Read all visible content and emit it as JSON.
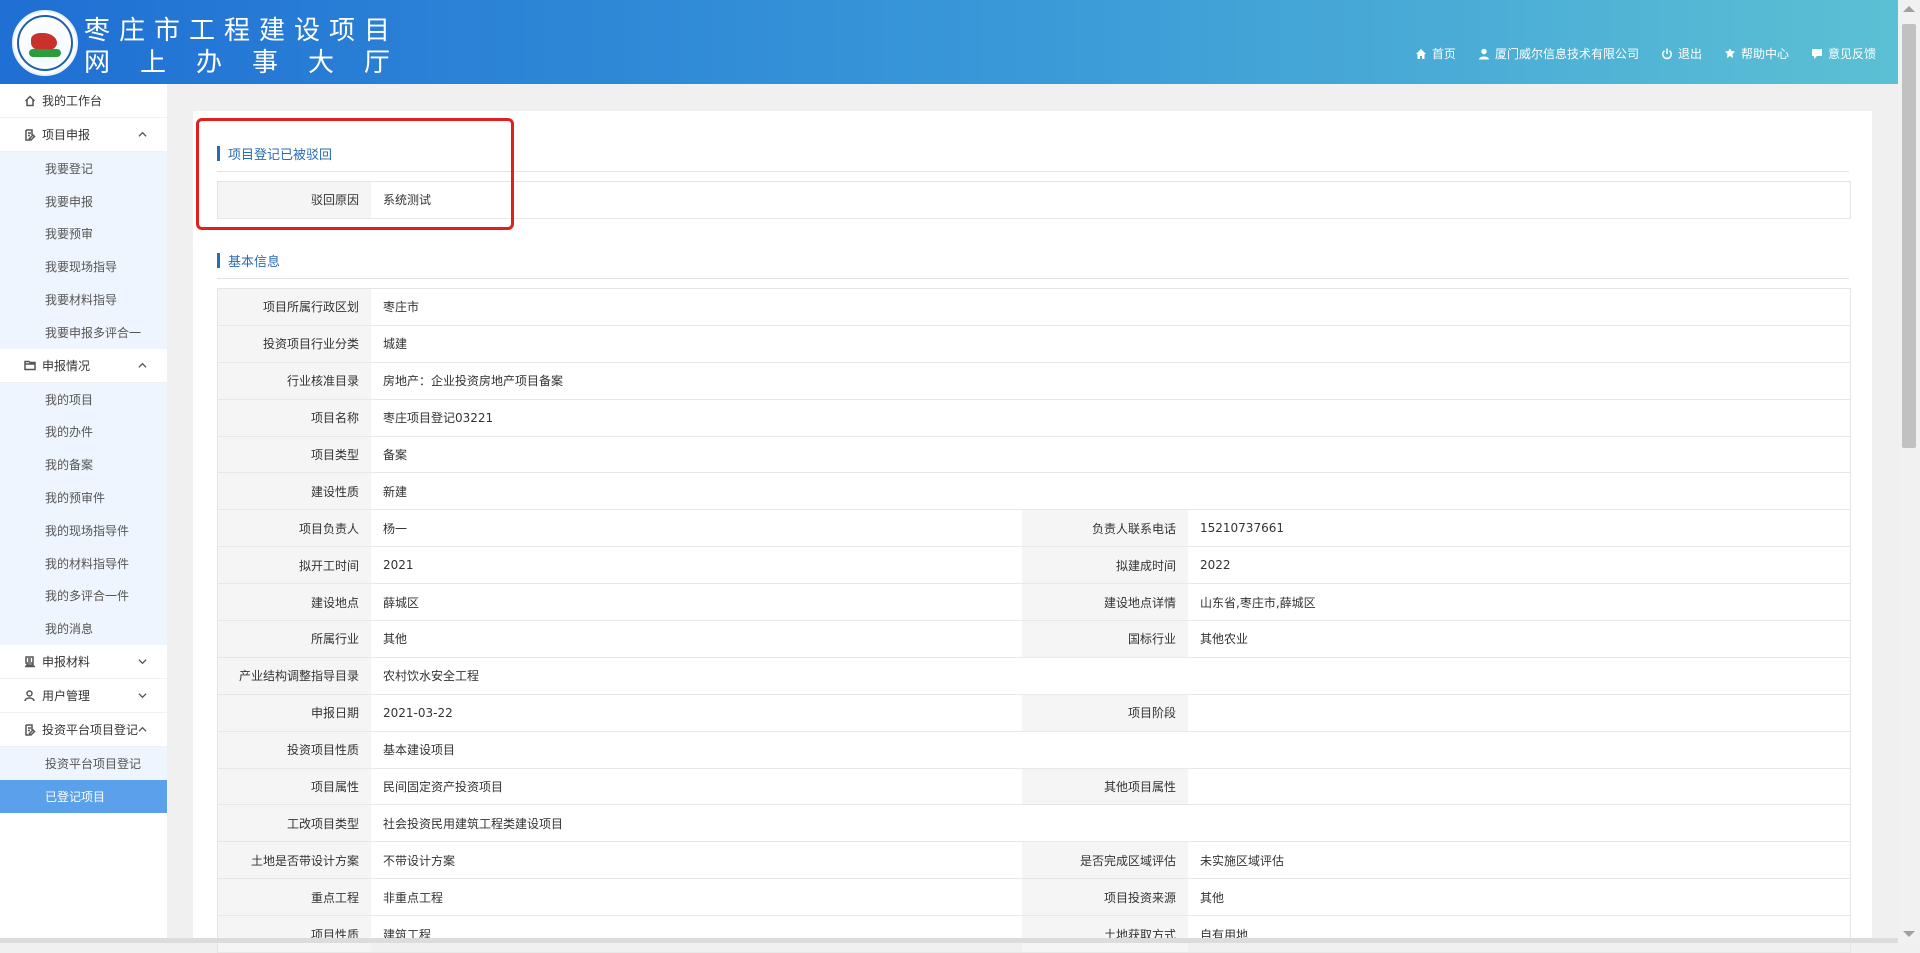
{
  "header": {
    "title_line1": "枣庄市工程建设项目",
    "title_line2": "网上办事大厅",
    "nav": [
      {
        "icon": "home-icon",
        "label": "首页"
      },
      {
        "icon": "user-icon",
        "label": "厦门威尔信息技术有限公司"
      },
      {
        "icon": "power-icon",
        "label": "退出"
      },
      {
        "icon": "help-icon",
        "label": "帮助中心"
      },
      {
        "icon": "feedback-icon",
        "label": "意见反馈"
      }
    ]
  },
  "sidebar": {
    "workbench": "我的工作台",
    "groups": [
      {
        "label": "项目申报",
        "expanded": true,
        "items": [
          "我要登记",
          "我要申报",
          "我要预审",
          "我要现场指导",
          "我要材料指导",
          "我要申报多评合一"
        ]
      },
      {
        "label": "申报情况",
        "expanded": true,
        "items": [
          "我的项目",
          "我的办件",
          "我的备案",
          "我的预审件",
          "我的现场指导件",
          "我的材料指导件",
          "我的多评合一件",
          "我的消息"
        ]
      },
      {
        "label": "申报材料",
        "expanded": false,
        "items": []
      },
      {
        "label": "用户管理",
        "expanded": false,
        "items": []
      },
      {
        "label": "投资平台项目登记",
        "expanded": true,
        "items": [
          "投资平台项目登记",
          "已登记项目"
        ]
      }
    ],
    "active_item": "已登记项目"
  },
  "rejected": {
    "title": "项目登记已被驳回",
    "reason_label": "驳回原因",
    "reason_value": "系统测试"
  },
  "basic": {
    "title": "基本信息",
    "rows": [
      [
        [
          "项目所属行政区划",
          "枣庄市"
        ]
      ],
      [
        [
          "投资项目行业分类",
          "城建"
        ]
      ],
      [
        [
          "行业核准目录",
          "房地产：企业投资房地产项目备案"
        ]
      ],
      [
        [
          "项目名称",
          "枣庄项目登记03221"
        ]
      ],
      [
        [
          "项目类型",
          "备案"
        ]
      ],
      [
        [
          "建设性质",
          "新建"
        ]
      ],
      [
        [
          "项目负责人",
          "杨一"
        ],
        [
          "负责人联系电话",
          "15210737661"
        ]
      ],
      [
        [
          "拟开工时间",
          "2021"
        ],
        [
          "拟建成时间",
          "2022"
        ]
      ],
      [
        [
          "建设地点",
          "薛城区"
        ],
        [
          "建设地点详情",
          "山东省,枣庄市,薛城区"
        ]
      ],
      [
        [
          "所属行业",
          "其他"
        ],
        [
          "国标行业",
          "其他农业"
        ]
      ],
      [
        [
          "产业结构调整指导目录",
          "农村饮水安全工程"
        ]
      ],
      [
        [
          "申报日期",
          "2021-03-22"
        ],
        [
          "项目阶段",
          ""
        ]
      ],
      [
        [
          "投资项目性质",
          "基本建设项目"
        ]
      ],
      [
        [
          "项目属性",
          "民间固定资产投资项目"
        ],
        [
          "其他项目属性",
          ""
        ]
      ],
      [
        [
          "工改项目类型",
          "社会投资民用建筑工程类建设项目"
        ]
      ],
      [
        [
          "土地是否带设计方案",
          "不带设计方案"
        ],
        [
          "是否完成区域评估",
          "未实施区域评估"
        ]
      ],
      [
        [
          "重点工程",
          "非重点工程"
        ],
        [
          "项目投资来源",
          "其他"
        ]
      ],
      [
        [
          "项目性质",
          "建筑工程"
        ],
        [
          "土地获取方式",
          "自有用地"
        ]
      ]
    ]
  }
}
